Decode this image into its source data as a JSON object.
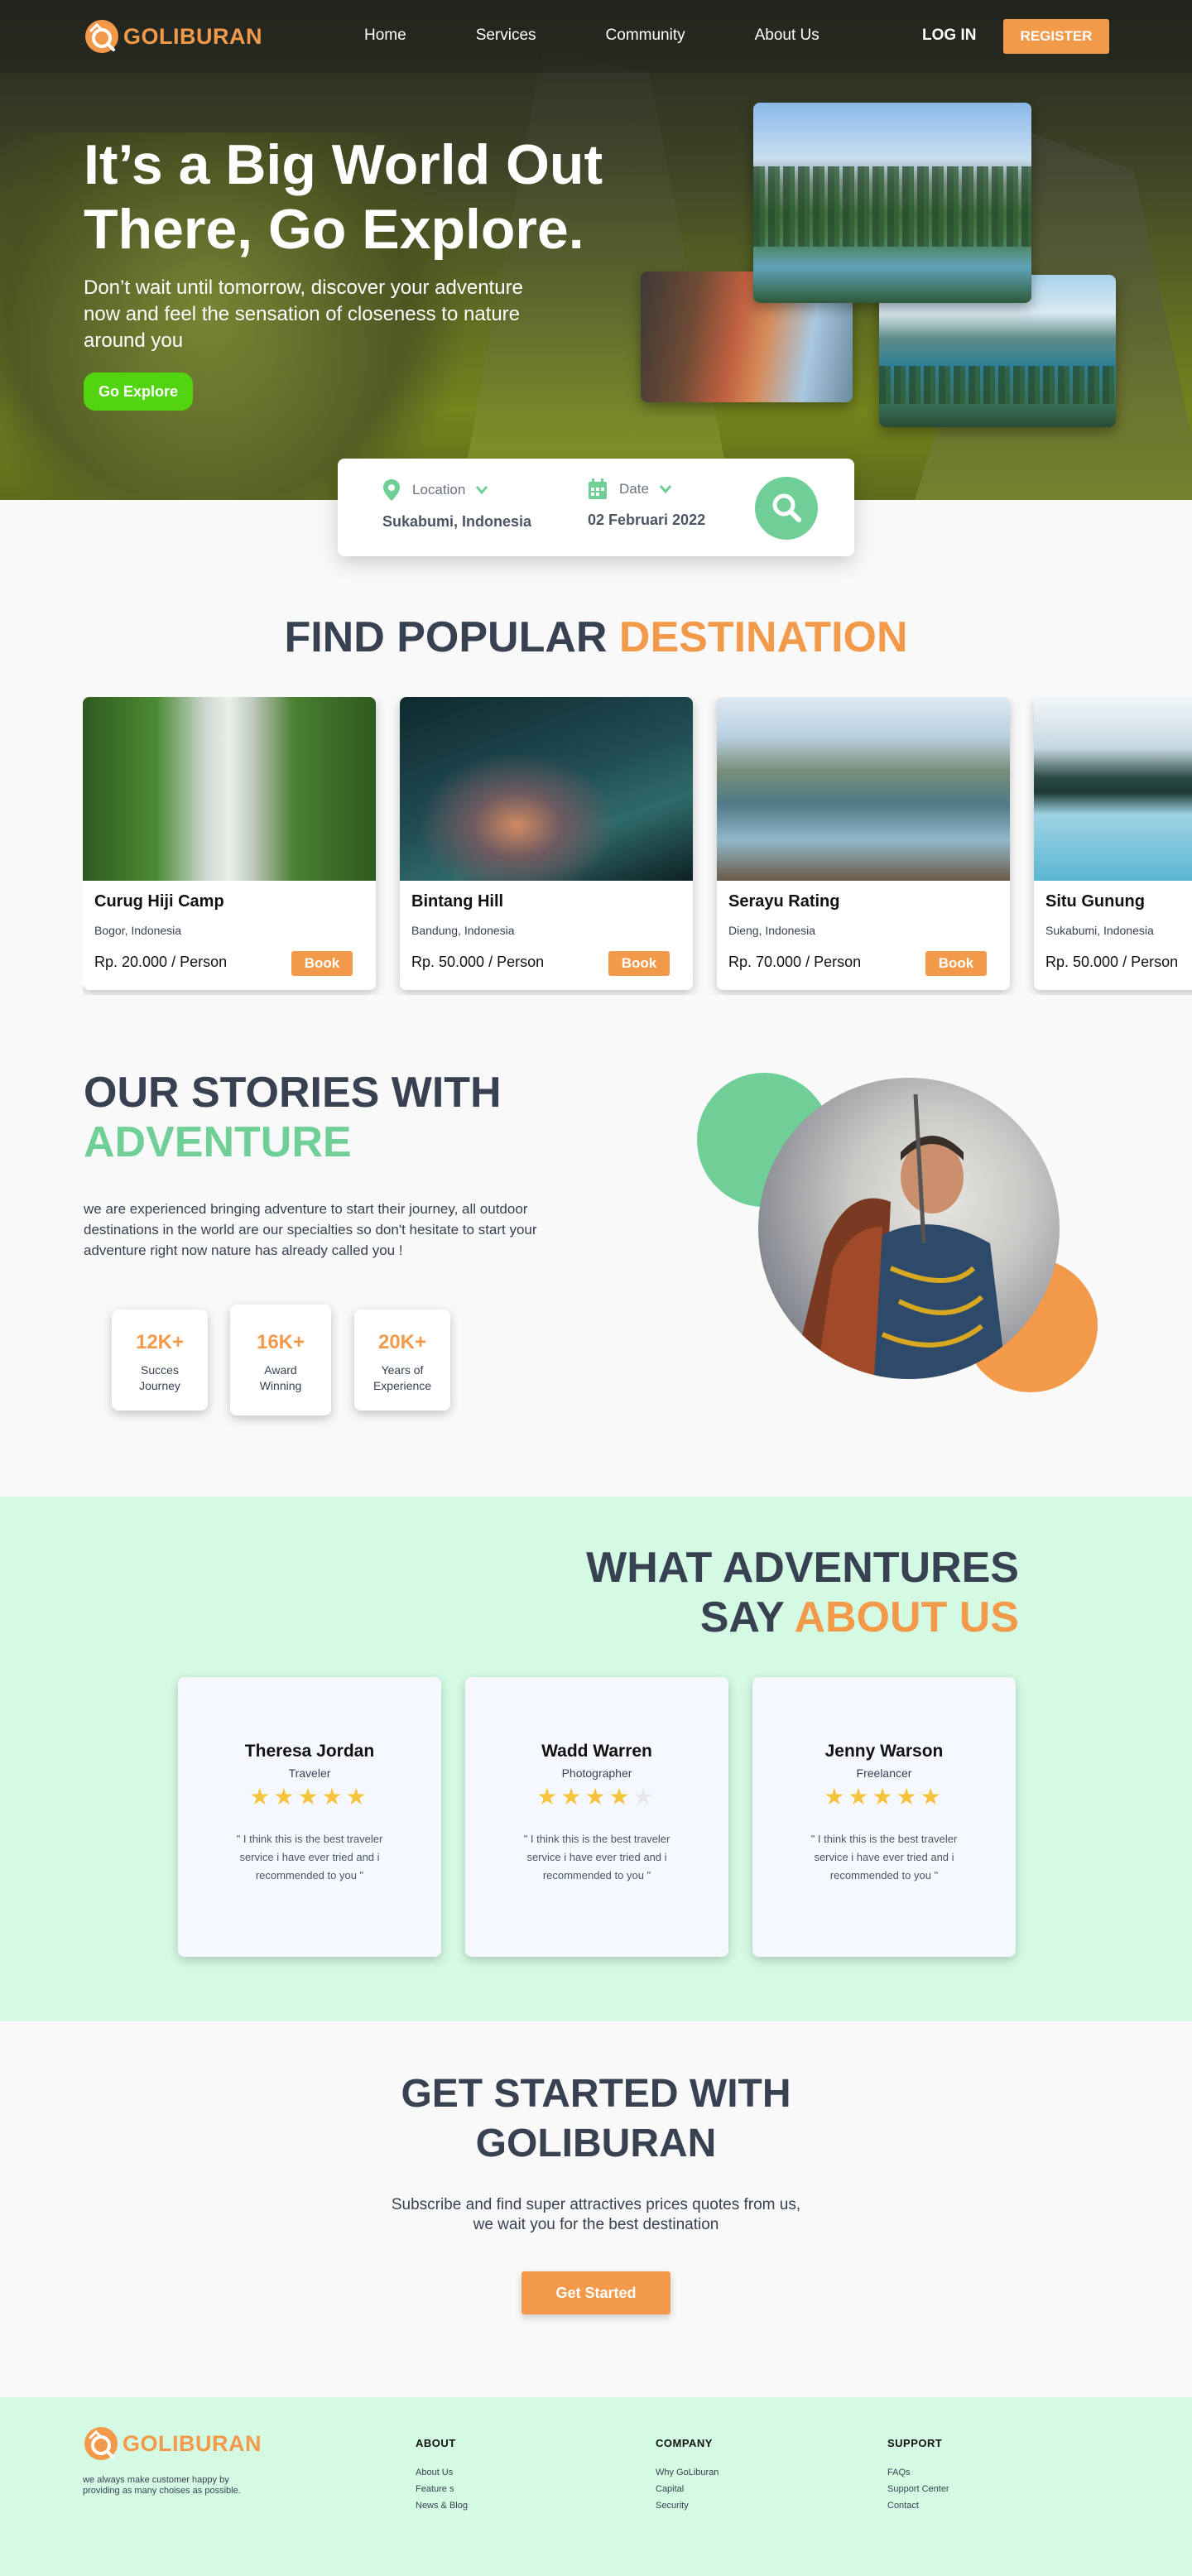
{
  "brand": {
    "name": "GOLIBURAN",
    "color": "#f2994a"
  },
  "nav": {
    "links": [
      "Home",
      "Services",
      "Community",
      "About Us"
    ],
    "login": "LOG IN",
    "register": "REGISTER"
  },
  "hero": {
    "title": "It’s a Big World Out There, Go Explore.",
    "subtitle": "Don’t wait until tomorrow, discover your adventure now and feel the sensation of closeness to nature around you",
    "cta": "Go Explore"
  },
  "search": {
    "location_label": "Location",
    "location_value": "Sukabumi, Indonesia",
    "date_label": "Date",
    "date_value": "02 Februari 2022",
    "button_icon": "search-icon"
  },
  "destinations": {
    "title_a": "FIND POPULAR",
    "title_b": "DESTINATION",
    "book_label": "Book",
    "items": [
      {
        "name": "Curug Hiji Camp",
        "location": "Bogor, Indonesia",
        "price": "Rp. 20.000 / Person"
      },
      {
        "name": "Bintang Hill",
        "location": "Bandung, Indonesia",
        "price": "Rp. 50.000 / Person"
      },
      {
        "name": "Serayu Rating",
        "location": "Dieng, Indonesia",
        "price": "Rp. 70.000 / Person"
      },
      {
        "name": "Situ Gunung",
        "location": "Sukabumi, Indonesia",
        "price": "Rp. 50.000 / Person"
      }
    ]
  },
  "stories": {
    "title_a": "OUR STORIES WITH",
    "title_b": "ADVENTURE",
    "text": "we are experienced bringing adventure to start their journey, all outdoor destinations in the world are our specialties so don't hesitate to start your adventure right now nature has already called you !",
    "stats": [
      {
        "value": "12K+",
        "label": "Succes Journey"
      },
      {
        "value": "16K+",
        "label": "Award Winning"
      },
      {
        "value": "20K+",
        "label": "Years of Experience"
      }
    ]
  },
  "testimonials": {
    "title_a": "WHAT ADVENTURES",
    "title_b": "SAY",
    "title_c": "ABOUT US",
    "items": [
      {
        "name": "Theresa Jordan",
        "role": "Traveler",
        "rating": 5,
        "quote": "\" I think this is the best traveler service i have ever tried and i recommended to you \""
      },
      {
        "name": "Wadd Warren",
        "role": "Photographer",
        "rating": 4,
        "quote": "\" I think this is the best traveler service i have ever tried and i recommended to you \""
      },
      {
        "name": "Jenny Warson",
        "role": "Freelancer",
        "rating": 5,
        "quote": "\" I think this is the best traveler service i have ever tried and i recommended to you \""
      }
    ]
  },
  "get_started": {
    "title": "GET STARTED WITH GOLIBURAN",
    "subtitle": "Subscribe and find super attractives prices quotes from us, we wait you for the best destination",
    "button": "Get Started"
  },
  "footer": {
    "tagline": "we always make customer happy by providing as many choises as possible.",
    "columns": [
      {
        "head": "ABOUT",
        "links": [
          "About Us",
          "Feature s",
          "News & Blog"
        ]
      },
      {
        "head": "COMPANY",
        "links": [
          "Why GoLiburan",
          "Capital",
          "Security"
        ]
      },
      {
        "head": "SUPPORT",
        "links": [
          "FAQs",
          "Support Center",
          "Contact"
        ]
      }
    ]
  },
  "colors": {
    "accent": "#f2994a",
    "green": "#6fcf97",
    "cta_green": "#52d411",
    "mint_bg": "#d4fae3"
  }
}
